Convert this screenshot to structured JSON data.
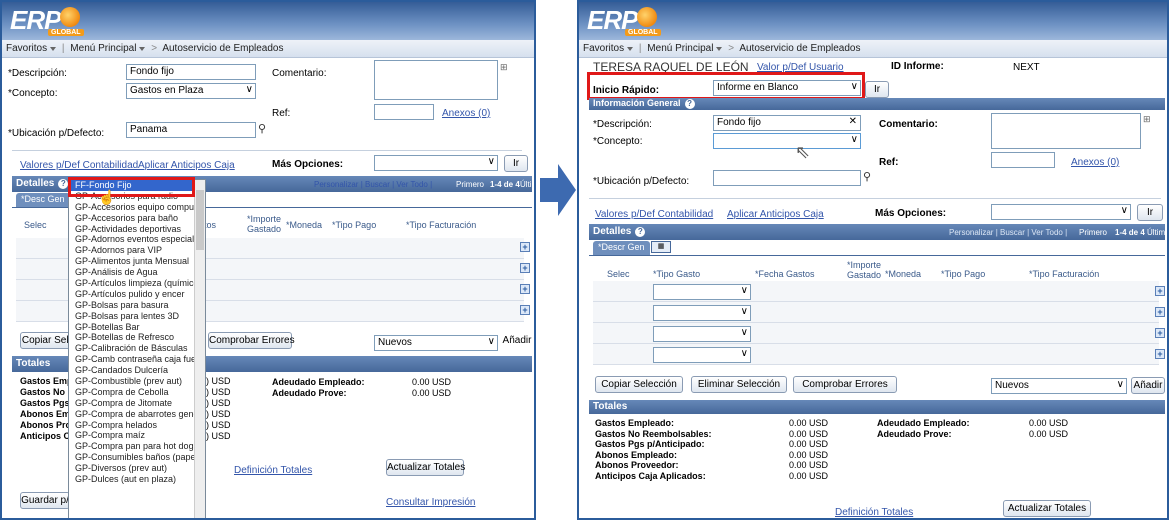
{
  "logo": {
    "text": "ERP",
    "sub": "GLOBAL"
  },
  "nav": {
    "favoritos": "Favoritos",
    "menu": "Menú Principal",
    "sep": ">",
    "current": "Autoservicio de Empleados"
  },
  "left": {
    "descripcion_label": "*Descripción:",
    "descripcion_value": "Fondo fijo",
    "comentario_label": "Comentario:",
    "concepto_label": "*Concepto:",
    "concepto_value": "Gastos en Plaza",
    "ref_label": "Ref:",
    "anexos": "Anexos (0)",
    "ubicacion_label": "*Ubicación p/Defecto:",
    "ubicacion_value": "Panama",
    "valores_link": "Valores p/Def Contabilidad",
    "aplicar_link": "Aplicar Anticipos Caja",
    "mas_opciones": "Más Opciones:",
    "ir": "Ir",
    "detalles": "Detalles",
    "desc_gen_tab": "*Desc Gen",
    "grid_nav": "Personalizar | Buscar | Ver Todo |",
    "grid_pages": "Primero",
    "grid_count": "1-4 de 4",
    "grid_last": "Último",
    "col_selec": "Selec",
    "col_tos": "tos",
    "col_importe": "*Importe Gastado",
    "col_moneda": "*Moneda",
    "col_tipo_pago": "*Tipo Pago",
    "col_tipo_fact": "*Tipo Facturación",
    "copiar_btn": "Copiar Sele",
    "comprobar_btn": "Comprobar Errores",
    "nuevos": "Nuevos",
    "anadir": "Añadir",
    "totales": "Totales",
    "tot_labels": [
      "Gastos Emplea",
      "Gastos No Ree",
      "Gastos Pgs p/A",
      "Abonos Emplea",
      "Abonos Provee",
      "Anticipos Caja"
    ],
    "tot_values": [
      ") USD",
      ") USD",
      ") USD",
      ") USD",
      ") USD",
      ") USD"
    ],
    "adeudado_emp": "Adeudado Empleado:",
    "adeudado_prov": "Adeudado Prove:",
    "adeudado_emp_val": "0.00 USD",
    "adeudado_prov_val": "0.00 USD",
    "actualizar_btn": "Actualizar Totales",
    "definicion_link": "Definición Totales",
    "guardar_btn": "Guardar p/",
    "consultar_link": "Consultar Impresión",
    "dropdown_items": [
      "FF-Fondo Fijo",
      "GP-Accesorios  para radio",
      "GP-Accesorios equipo computo",
      "GP-Accesorios para baño",
      "GP-Actividades deportivas",
      "GP-Adornos eventos especiales",
      "GP-Adornos para VIP",
      "GP-Alimentos junta Mensual",
      "GP-Análisis de Agua",
      "GP-Artículos limpieza (químico",
      "GP-Artículos pulido y encer",
      "GP-Bolsas para basura",
      "GP-Bolsas para lentes 3D",
      "GP-Botellas Bar",
      "GP-Botellas de Refresco",
      "GP-Calibración de Básculas",
      "GP-Camb contraseña caja fuerte",
      "GP-Candados Dulcería",
      "GP-Combustible (prev aut)",
      "GP-Compra de Cebolla",
      "GP-Compra de Jitomate",
      "GP-Compra de abarrotes general",
      "GP-Compra helados",
      "GP-Compra maíz",
      "GP-Compra pan para hot dog",
      "GP-Consumibles baños (papel)",
      "GP-Diversos (prev aut)",
      "GP-Dulces (aut en plaza)"
    ]
  },
  "right": {
    "employee_name": "TERESA RAQUEL DE LEÓN",
    "valor_link": "Valor p/Def Usuario",
    "id_label": "ID Informe:",
    "id_value": "NEXT",
    "inicio_label": "Inicio Rápido:",
    "inicio_value": "Informe en Blanco",
    "ir": "Ir",
    "info_general": "Información General",
    "descripcion_label": "*Descripción:",
    "descripcion_value": "Fondo fijo",
    "comentario_label": "Comentario:",
    "concepto_label": "*Concepto:",
    "concepto_value": "",
    "ref_label": "Ref:",
    "anexos": "Anexos (0)",
    "ubicacion_label": "*Ubicación p/Defecto:",
    "ubicacion_value": "",
    "valores_link": "Valores p/Def Contabilidad",
    "aplicar_link": "Aplicar Anticipos Caja",
    "mas_opciones": "Más Opciones:",
    "detalles": "Detalles",
    "desc_gen_tab": "*Descr Gen",
    "grid_nav": "Personalizar | Buscar | Ver Todo |",
    "grid_pages": "Primero",
    "grid_count": "1-4 de 4",
    "grid_last": "Último",
    "col_selec": "Selec",
    "col_tipo_gasto": "*Tipo Gasto",
    "col_fecha": "*Fecha Gastos",
    "col_importe": "*Importe Gastado",
    "col_moneda": "*Moneda",
    "col_tipo_pago": "*Tipo Pago",
    "col_tipo_fact": "*Tipo Facturación",
    "copiar_btn": "Copiar Selección",
    "eliminar_btn": "Eliminar Selección",
    "comprobar_btn": "Comprobar Errores",
    "nuevos": "Nuevos",
    "anadir": "Añadir",
    "totales": "Totales",
    "tot_labels": [
      "Gastos Empleado:",
      "Gastos No Reembolsables:",
      "Gastos Pgs p/Anticipado:",
      "Abonos Empleado:",
      "Abonos Proveedor:",
      "Anticipos Caja Aplicados:"
    ],
    "tot_values": [
      "0.00 USD",
      "0.00 USD",
      "0.00 USD",
      "0.00 USD",
      "0.00 USD",
      "0.00 USD"
    ],
    "adeudado_emp": "Adeudado Empleado:",
    "adeudado_prov": "Adeudado Prove:",
    "adeudado_emp_val": "0.00 USD",
    "adeudado_prov_val": "0.00 USD",
    "actualizar_btn": "Actualizar Totales",
    "definicion_link": "Definición Totales"
  },
  "colors": {
    "header": "#355d97",
    "section": "#46689a",
    "highlight": "#e01818",
    "arrow": "#3d6ab0"
  }
}
